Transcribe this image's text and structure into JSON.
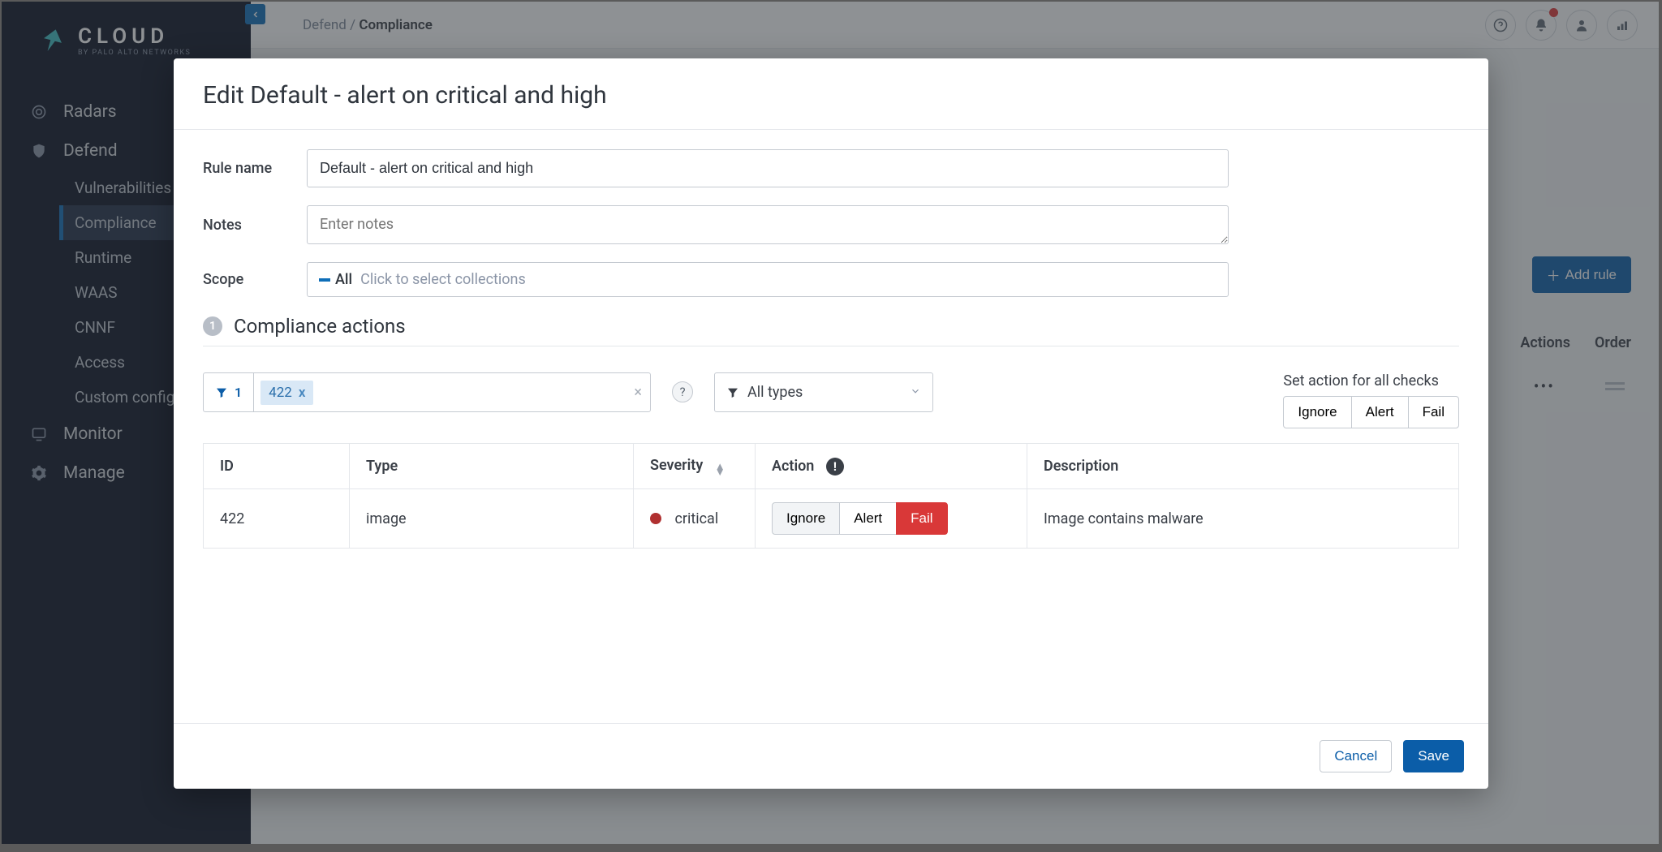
{
  "logo": {
    "text": "CLOUD",
    "subtitle": "BY PALO ALTO NETWORKS"
  },
  "breadcrumb": {
    "parent": "Defend",
    "sep": "/",
    "current": "Compliance"
  },
  "nav": {
    "radars": "Radars",
    "defend": "Defend",
    "sub": {
      "vuln": "Vulnerabilities",
      "comp": "Compliance",
      "runtime": "Runtime",
      "waas": "WAAS",
      "cnnf": "CNNF",
      "access": "Access",
      "custom": "Custom configs"
    },
    "monitor": "Monitor",
    "manage": "Manage"
  },
  "toolbar": {
    "add_rule": "Add rule"
  },
  "table_frag": {
    "actions": "Actions",
    "order": "Order",
    "dots": "•••"
  },
  "modal": {
    "title": "Edit Default - alert on critical and high",
    "labels": {
      "rule_name": "Rule name",
      "notes": "Notes",
      "scope": "Scope"
    },
    "rule_name_value": "Default - alert on critical and high",
    "notes_placeholder": "Enter notes",
    "scope": {
      "all": "All",
      "placeholder": "Click to select collections"
    },
    "section": {
      "num": "1",
      "title": "Compliance actions"
    },
    "filter": {
      "count": "1",
      "chip": "422",
      "chip_x": "x",
      "clear": "×"
    },
    "types": "All types",
    "set_all": "Set action for all checks",
    "buttons": {
      "ignore": "Ignore",
      "alert": "Alert",
      "fail": "Fail"
    },
    "cols": {
      "id": "ID",
      "type": "Type",
      "severity": "Severity",
      "action": "Action",
      "description": "Description"
    },
    "rows": [
      {
        "id": "422",
        "type": "image",
        "severity": "critical",
        "action": "Fail",
        "description": "Image contains malware"
      }
    ],
    "footer": {
      "cancel": "Cancel",
      "save": "Save"
    }
  }
}
